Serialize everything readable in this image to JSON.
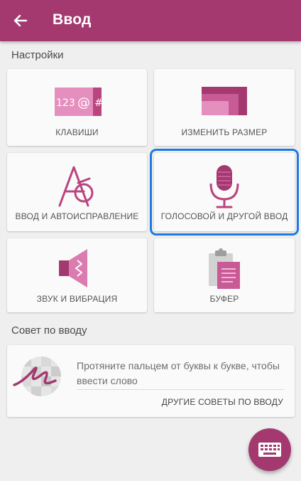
{
  "appbar": {
    "title": "Ввод",
    "back_icon": "arrow-left-icon"
  },
  "settings": {
    "section_title": "Настройки",
    "tiles": [
      {
        "label": "КЛАВИШИ",
        "icon": "keys-icon"
      },
      {
        "label": "ИЗМЕНИТЬ РАЗМЕР",
        "icon": "resize-icon"
      },
      {
        "label": "ВВОД И АВТОИСПРАВЛЕНИЕ",
        "icon": "autocorrect-icon"
      },
      {
        "label": "ГОЛОСОВОЙ И ДРУГОЙ ВВОД",
        "icon": "microphone-icon",
        "selected": true
      },
      {
        "label": "ЗВУК И ВИБРАЦИЯ",
        "icon": "speaker-icon"
      },
      {
        "label": "БУФЕР",
        "icon": "clipboard-icon"
      }
    ]
  },
  "tip": {
    "section_title": "Совет по вводу",
    "text": "Протяните пальцем от буквы к букве, чтобы ввести слово",
    "link": "ДРУГИЕ СОВЕТЫ ПО ВВОДУ"
  },
  "fab": {
    "icon": "keyboard-icon"
  },
  "colors": {
    "primary": "#a3396f",
    "accent_light": "#e58fbf",
    "selection": "#1e7ae0",
    "background": "#efefef"
  }
}
